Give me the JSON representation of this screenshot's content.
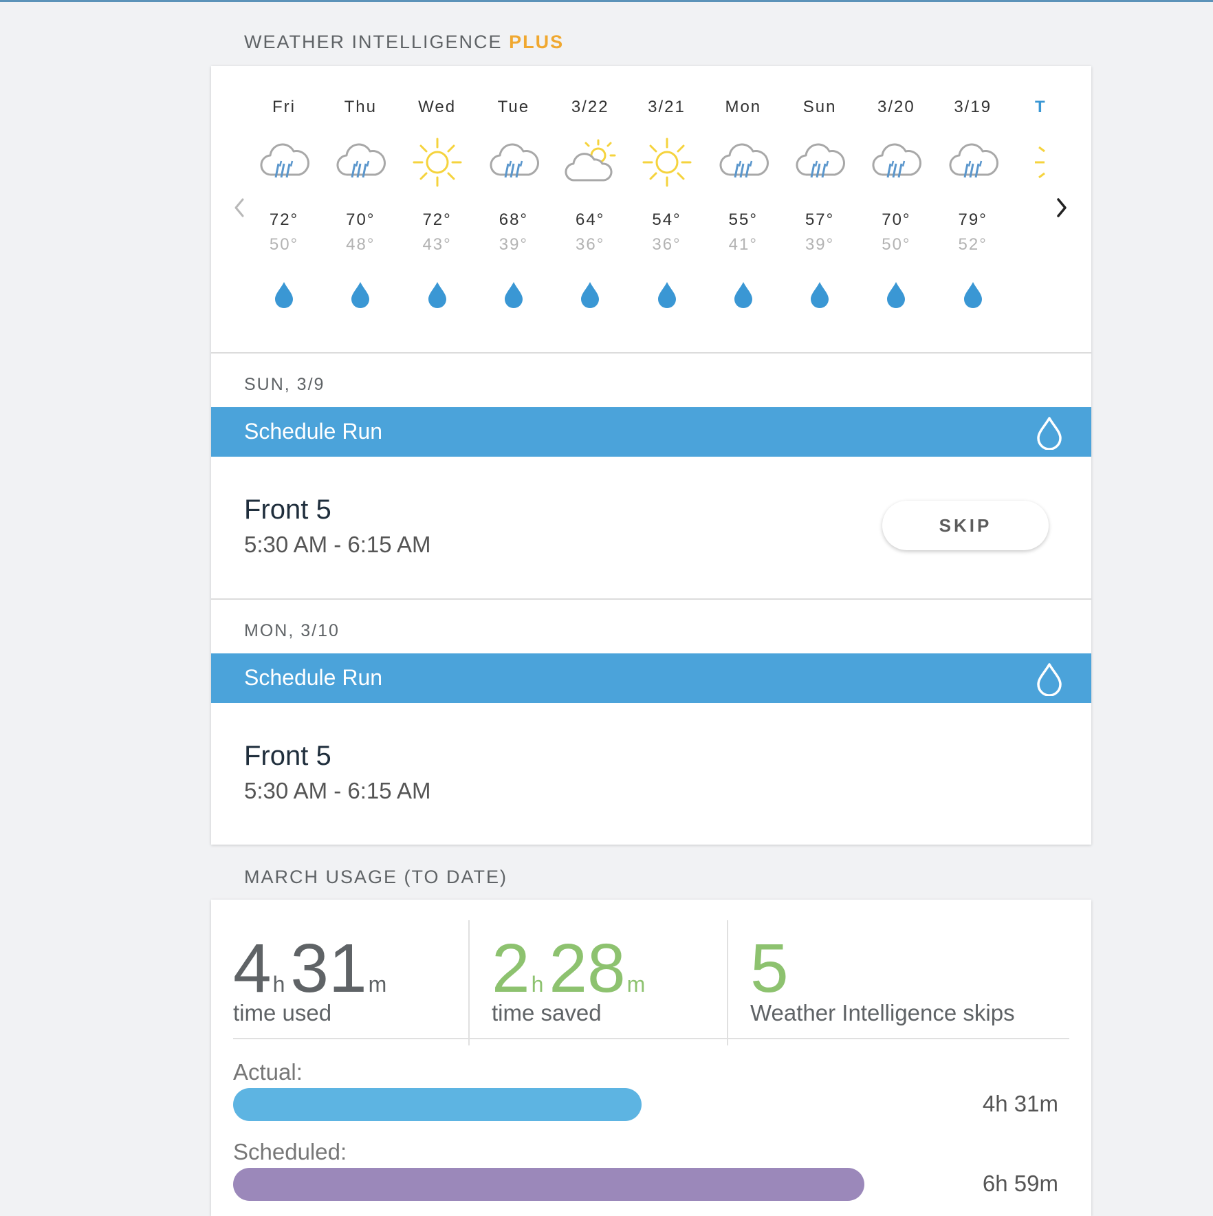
{
  "header": {
    "title": "WEATHER INTELLIGENCE",
    "title_accent": "PLUS"
  },
  "forecast": {
    "days": [
      {
        "label": "Fri",
        "icon": "rain-cloud-icon",
        "hi": "72°",
        "lo": "50°"
      },
      {
        "label": "Thu",
        "icon": "rain-cloud-icon",
        "hi": "70°",
        "lo": "48°"
      },
      {
        "label": "Wed",
        "icon": "sun-icon",
        "hi": "72°",
        "lo": "43°"
      },
      {
        "label": "Tue",
        "icon": "rain-cloud-icon",
        "hi": "68°",
        "lo": "39°"
      },
      {
        "label": "3/22",
        "icon": "partly-cloudy-icon",
        "hi": "64°",
        "lo": "36°"
      },
      {
        "label": "3/21",
        "icon": "sun-icon",
        "hi": "54°",
        "lo": "36°"
      },
      {
        "label": "Mon",
        "icon": "rain-cloud-icon",
        "hi": "55°",
        "lo": "41°"
      },
      {
        "label": "Sun",
        "icon": "rain-cloud-icon",
        "hi": "57°",
        "lo": "39°"
      },
      {
        "label": "3/20",
        "icon": "rain-cloud-icon",
        "hi": "70°",
        "lo": "50°"
      },
      {
        "label": "3/19",
        "icon": "rain-cloud-icon",
        "hi": "79°",
        "lo": "52°"
      }
    ],
    "partial_day_label": "T",
    "precip_icon": "water-drop-icon"
  },
  "schedule": [
    {
      "date": "SUN, 3/9",
      "run_label": "Schedule Run",
      "zone": "Front 5",
      "time": "5:30 AM - 6:15 AM",
      "skip_label": "SKIP"
    },
    {
      "date": "MON, 3/10",
      "run_label": "Schedule Run",
      "zone": "Front 5",
      "time": "5:30 AM - 6:15 AM"
    }
  ],
  "usage": {
    "title": "MARCH USAGE (TO DATE)",
    "time_used": {
      "hours": "4",
      "h_unit": "h",
      "minutes": "31",
      "m_unit": "m",
      "label": "time used"
    },
    "time_saved": {
      "hours": "2",
      "h_unit": "h",
      "minutes": "28",
      "m_unit": "m",
      "label": "time saved"
    },
    "skips": {
      "value": "5",
      "label": "Weather Intelligence skips"
    },
    "bars": [
      {
        "label": "Actual:",
        "value": "4h 31m",
        "minutes": 271,
        "color": "#5db4e2"
      },
      {
        "label": "Scheduled:",
        "value": "6h 59m",
        "minutes": 419,
        "color": "#9b88ba"
      }
    ],
    "bar_max_minutes": 479
  },
  "colors": {
    "accent_blue": "#4ba3da",
    "plus_orange": "#f0a830",
    "saved_green": "#8dc26f",
    "drop_blue": "#3a97d4",
    "sun_yellow": "#f5d33d"
  }
}
